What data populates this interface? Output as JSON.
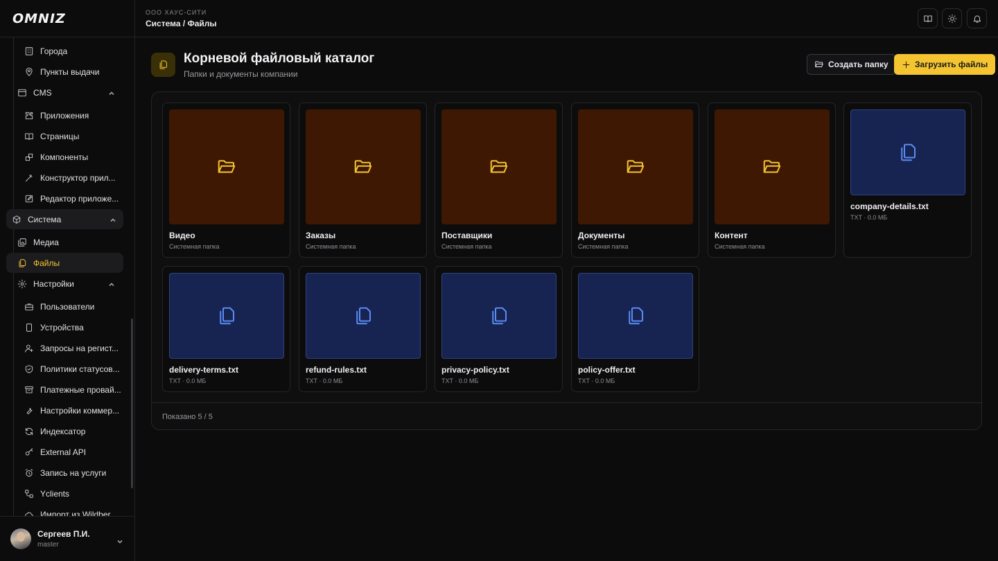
{
  "app": {
    "logo": "OMNIZ"
  },
  "header": {
    "org": "ООО ХАУС-СИТИ",
    "breadcrumb": "Система / Файлы",
    "actions": [
      {
        "icon": "book-open-icon"
      },
      {
        "icon": "sun-icon"
      },
      {
        "icon": "bell-icon"
      }
    ]
  },
  "sidebar": {
    "items": [
      {
        "label": "Города",
        "icon": "building-icon",
        "level": "sub"
      },
      {
        "label": "Пункты выдачи",
        "icon": "map-pin-icon",
        "level": "sub"
      },
      {
        "label": "CMS",
        "icon": "window-icon",
        "level": "group",
        "expanded": true
      },
      {
        "label": "Приложения",
        "icon": "puzzle-icon",
        "level": "sub"
      },
      {
        "label": "Страницы",
        "icon": "book-icon",
        "level": "sub"
      },
      {
        "label": "Компоненты",
        "icon": "blocks-icon",
        "level": "sub"
      },
      {
        "label": "Конструктор прил...",
        "icon": "wand-icon",
        "level": "sub"
      },
      {
        "label": "Редактор приложе...",
        "icon": "edit-icon",
        "level": "sub"
      },
      {
        "label": "Система",
        "icon": "box-icon",
        "level": "top",
        "expanded": true
      },
      {
        "label": "Медиа",
        "icon": "images-icon",
        "level": "group"
      },
      {
        "label": "Файлы",
        "icon": "files-icon",
        "level": "group",
        "active": true
      },
      {
        "label": "Настройки",
        "icon": "gear-icon",
        "level": "group",
        "expanded": true
      },
      {
        "label": "Пользователи",
        "icon": "briefcase-icon",
        "level": "sub"
      },
      {
        "label": "Устройства",
        "icon": "smartphone-icon",
        "level": "sub"
      },
      {
        "label": "Запросы на регист...",
        "icon": "user-plus-icon",
        "level": "sub"
      },
      {
        "label": "Политики статусов...",
        "icon": "shield-icon",
        "level": "sub"
      },
      {
        "label": "Платежные провай...",
        "icon": "archive-icon",
        "level": "sub"
      },
      {
        "label": "Настройки коммер...",
        "icon": "wrench-icon",
        "level": "sub"
      },
      {
        "label": "Индексатор",
        "icon": "refresh-icon",
        "level": "sub"
      },
      {
        "label": "External API",
        "icon": "key-icon",
        "level": "sub"
      },
      {
        "label": "Запись на услуги",
        "icon": "alarm-clock-icon",
        "level": "sub"
      },
      {
        "label": "Yclients",
        "icon": "workflow-icon",
        "level": "sub"
      },
      {
        "label": "Импорт из Wildber...",
        "icon": "cloud-icon",
        "level": "sub"
      }
    ],
    "user": {
      "name": "Сергеев П.И.",
      "role": "master"
    }
  },
  "main": {
    "title": "Корневой файловый каталог",
    "subtitle": "Папки и документы компании",
    "create_folder_label": "Создать папку",
    "upload_label": "Загрузить файлы",
    "items": [
      {
        "name": "Видео",
        "meta": "Системная папка",
        "type": "folder"
      },
      {
        "name": "Заказы",
        "meta": "Системная папка",
        "type": "folder"
      },
      {
        "name": "Поставщики",
        "meta": "Системная папка",
        "type": "folder"
      },
      {
        "name": "Документы",
        "meta": "Системная папка",
        "type": "folder"
      },
      {
        "name": "Контент",
        "meta": "Системная папка",
        "type": "folder"
      },
      {
        "name": "company-details.txt",
        "meta": "TXT · 0.0 МБ",
        "type": "file"
      },
      {
        "name": "delivery-terms.txt",
        "meta": "TXT · 0.0 МБ",
        "type": "file"
      },
      {
        "name": "refund-rules.txt",
        "meta": "TXT · 0.0 МБ",
        "type": "file"
      },
      {
        "name": "privacy-policy.txt",
        "meta": "TXT · 0.0 МБ",
        "type": "file"
      },
      {
        "name": "policy-offer.txt",
        "meta": "TXT · 0.0 МБ",
        "type": "file"
      }
    ],
    "footer": "Показано 5 / 5"
  },
  "colors": {
    "accent": "#f4c531",
    "folder_bg": "#3e1803",
    "file_bg": "#172452",
    "file_icon": "#5b8cf2"
  }
}
